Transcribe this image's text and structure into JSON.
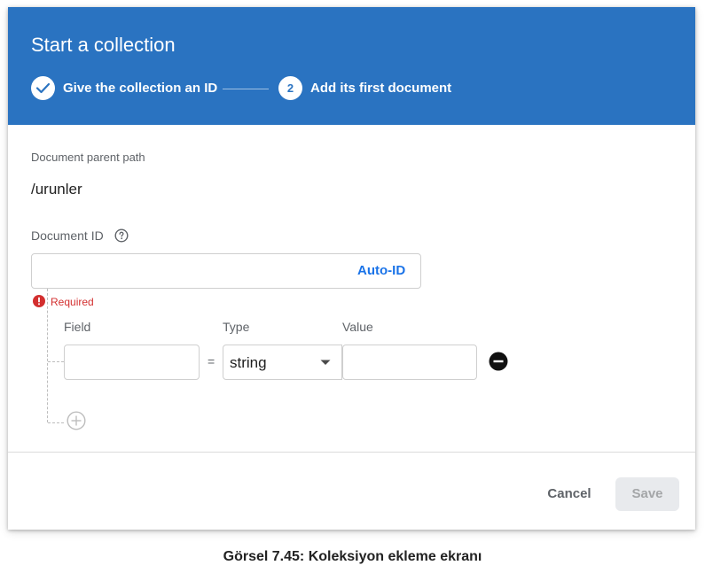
{
  "header": {
    "title": "Start a collection",
    "steps": [
      {
        "number": "",
        "label": "Give the collection an ID",
        "state": "done"
      },
      {
        "number": "2",
        "label": "Add its first document",
        "state": "active"
      }
    ]
  },
  "document": {
    "parent_path_label": "Document parent path",
    "parent_path_value": "/urunler",
    "id_label": "Document ID",
    "id_value": "",
    "auto_id_label": "Auto-ID",
    "required_text": "Required"
  },
  "fields": {
    "columns": {
      "field": "Field",
      "type": "Type",
      "value": "Value"
    },
    "rows": [
      {
        "field": "",
        "equals": "=",
        "type": "string",
        "value": ""
      }
    ]
  },
  "footer": {
    "cancel_label": "Cancel",
    "save_label": "Save"
  },
  "caption": "Görsel 7.45: Koleksiyon ekleme ekranı",
  "colors": {
    "header_bg": "#2a73c1",
    "accent": "#1a73e8",
    "error": "#d32f2f",
    "disabled_bg": "#e8eaed"
  },
  "icons": [
    "check-icon",
    "help-icon",
    "error-icon",
    "dropdown-arrow-icon",
    "remove-icon",
    "add-icon"
  ]
}
